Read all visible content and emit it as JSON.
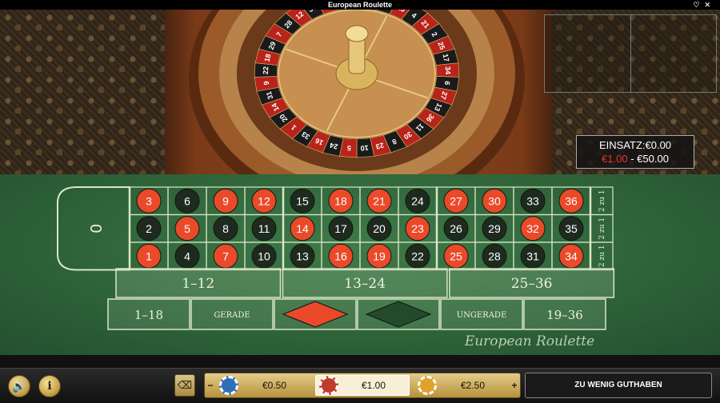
{
  "window": {
    "title": "European Roulette"
  },
  "wheel": {
    "numbers": [
      "0",
      "32",
      "15",
      "19",
      "4",
      "21",
      "2",
      "25",
      "17",
      "34",
      "6",
      "27",
      "13",
      "36",
      "11",
      "30",
      "8",
      "23",
      "10",
      "5",
      "24",
      "16",
      "33",
      "1",
      "20",
      "14",
      "31",
      "9",
      "22",
      "18",
      "29",
      "7",
      "28",
      "12",
      "35",
      "3",
      "26"
    ]
  },
  "limits": {
    "stake_label": "EINSATZ:",
    "stake_value": "€0.00",
    "min": "€1.00",
    "separator": " - ",
    "max": "€50.00"
  },
  "table": {
    "zero": "0",
    "grid": [
      [
        "3",
        "6",
        "9",
        "12",
        "15",
        "18",
        "21",
        "24",
        "27",
        "30",
        "33",
        "36"
      ],
      [
        "2",
        "5",
        "8",
        "11",
        "14",
        "17",
        "20",
        "23",
        "26",
        "29",
        "32",
        "35"
      ],
      [
        "1",
        "4",
        "7",
        "10",
        "13",
        "16",
        "19",
        "22",
        "25",
        "28",
        "31",
        "34"
      ]
    ],
    "reds": [
      "1",
      "3",
      "5",
      "7",
      "9",
      "12",
      "14",
      "16",
      "18",
      "19",
      "21",
      "23",
      "25",
      "27",
      "30",
      "32",
      "34",
      "36"
    ],
    "columns": [
      "2 zu 1",
      "2 zu 1",
      "2 zu 1"
    ],
    "dozens": [
      "1–12",
      "13–24",
      "25–36"
    ],
    "even_money": {
      "low": "1–18",
      "even": "GERADE",
      "odd": "UNGERADE",
      "high": "19–36"
    },
    "logo": "European Roulette"
  },
  "colors": {
    "red": "#ea4a2a",
    "black": "#1f2a1f",
    "felt": "#2f6439",
    "line": "#d9e6c8"
  },
  "bottom": {
    "sound_icon": "speaker-icon",
    "info_label": "i",
    "chips": [
      {
        "value": "€0.50",
        "color": "#2f6fb8",
        "selected": false
      },
      {
        "value": "€1.00",
        "color": "#c23a2a",
        "selected": true
      },
      {
        "value": "€2.50",
        "color": "#e0a22a",
        "selected": false
      }
    ],
    "minus": "−",
    "plus": "+",
    "status": "ZU WENIG GUTHABEN"
  }
}
